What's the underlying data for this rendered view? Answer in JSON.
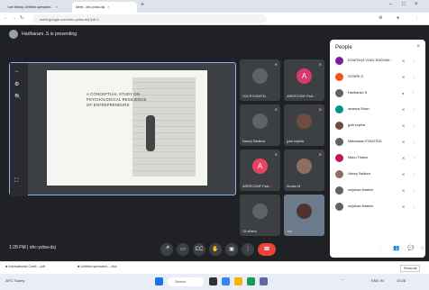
{
  "browser": {
    "tabs": [
      {
        "label": "I am Manoj: Untitled spreadsh..."
      },
      {
        "label": "Meet - ohc-ycbw-dzj"
      }
    ],
    "url": "meet.google.com/ohc-ycbw-dzj?pli=1"
  },
  "meet": {
    "presenting_label": "Hariharani .S is presenting",
    "slide": {
      "title_lines": [
        "A CONCEPTUAL STUDY ON",
        "PSYCHOLOGICAL RESILIENCE",
        "OF ENTREPRENEURS"
      ]
    },
    "tiles": [
      {
        "name": "VIJI R E20ATN...",
        "initial": "",
        "color": "#5f6368"
      },
      {
        "name": "AREECONF Part...",
        "initial": "A",
        "color": "#d93a6b"
      },
      {
        "name": "Nancy Sadiora",
        "initial": "",
        "color": "#5f6368"
      },
      {
        "name": "jyoti sophia",
        "initial": "",
        "color": "#5f6368"
      },
      {
        "name": "AREECONF Part...",
        "initial": "A",
        "color": "#e84362"
      },
      {
        "name": "Amala M",
        "initial": "",
        "color": "#5f6368"
      },
      {
        "name": "15 others",
        "initial": "",
        "color": "#5f6368"
      },
      {
        "name": "You",
        "initial": "",
        "color": "#5f6368"
      }
    ],
    "meeting_info": "1:28 PM  |  ohc-ycbw-dzj",
    "controls": [
      "mic-icon",
      "camera-icon",
      "captions-icon",
      "raise-hand-icon",
      "present-icon",
      "more-icon"
    ]
  },
  "people_panel": {
    "title": "People",
    "participants": [
      {
        "name": "E20ATN14 VIJAY RAGHAV...",
        "color": "#7b1fa2"
      },
      {
        "name": "GOWRI G",
        "color": "#f4511e"
      },
      {
        "name": "Hariharani S",
        "color": "#5f6368"
      },
      {
        "name": "lavanya Sivan",
        "color": "#009688"
      },
      {
        "name": "jyoti sophia",
        "color": "#6d4c41"
      },
      {
        "name": "Maheswari E20ATS16",
        "color": "#5f6368"
      },
      {
        "name": "Manu Thakur",
        "color": "#c2185b"
      },
      {
        "name": "Nancy Sadiora",
        "color": "#8d6e63"
      },
      {
        "name": "nurjahan ibrahim",
        "color": "#5f6368"
      },
      {
        "name": "nurjahan ibrahim",
        "color": "#5f6368"
      }
    ]
  },
  "downloads": [
    {
      "label": "International Confr....pdf"
    },
    {
      "label": "Untitled spreadsh....xlsx"
    }
  ],
  "downloads_show_all": "Show all",
  "taskbar": {
    "search_label": "Search",
    "weather": "28°C Sunny",
    "lang": "ENG IN",
    "time": "13:28"
  }
}
